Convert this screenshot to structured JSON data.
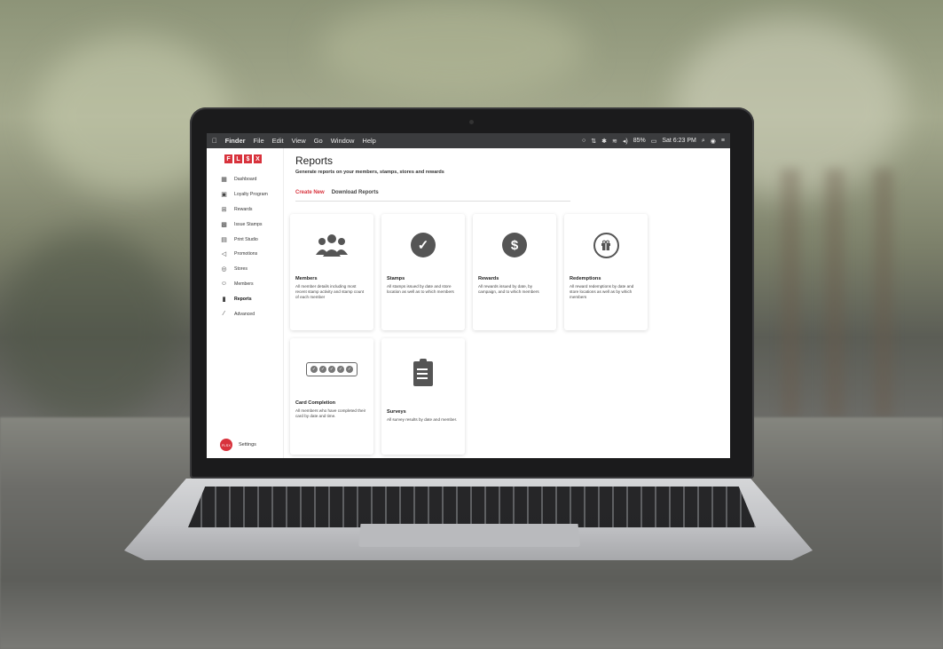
{
  "menubar": {
    "apple": "",
    "items": [
      "Finder",
      "File",
      "Edit",
      "View",
      "Go",
      "Window",
      "Help"
    ],
    "battery": "85%",
    "clock": "Sat 6:23 PM"
  },
  "app": {
    "logo_letters": [
      "F",
      "L",
      "$",
      "X"
    ],
    "nav": [
      {
        "label": "Dashboard",
        "icon": "dashboard-icon",
        "glyph": "▦"
      },
      {
        "label": "Loyalty Program",
        "icon": "loyalty-icon",
        "glyph": "▣"
      },
      {
        "label": "Rewards",
        "icon": "gift-icon",
        "glyph": "⊞"
      },
      {
        "label": "Issue Stamps",
        "icon": "qr-icon",
        "glyph": "▩"
      },
      {
        "label": "Print Studio",
        "icon": "print-icon",
        "glyph": "▤"
      },
      {
        "label": "Promotions",
        "icon": "megaphone-icon",
        "glyph": "◁"
      },
      {
        "label": "Stores",
        "icon": "location-icon",
        "glyph": "◎"
      },
      {
        "label": "Members",
        "icon": "members-icon",
        "glyph": "☺"
      },
      {
        "label": "Reports",
        "icon": "reports-icon",
        "glyph": "▮"
      },
      {
        "label": "Advanced",
        "icon": "wand-icon",
        "glyph": "⁄"
      }
    ],
    "active_nav": "Reports",
    "settings_label": "Settings",
    "avatar_text": "FLSX"
  },
  "page": {
    "title": "Reports",
    "subtitle": "Generate reports on your members, stamps, stores and rewards",
    "tabs": [
      "Create New",
      "Download Reports"
    ],
    "active_tab": "Create New"
  },
  "cards": [
    {
      "title": "Members",
      "desc": "All member details including most recent stamp activity and stamp count of each member",
      "icon": "users-icon"
    },
    {
      "title": "Stamps",
      "desc": "All stamps issued by date and store location as well as to which members",
      "icon": "checkmark-icon"
    },
    {
      "title": "Rewards",
      "desc": "All rewards issued by date, by campaign, and to which members",
      "icon": "dollar-icon"
    },
    {
      "title": "Redemptions",
      "desc": "All reward redemptions by date and store locations as well as by which members",
      "icon": "gift-icon"
    },
    {
      "title": "Card Completion",
      "desc": "All members who have completed their card by date and time.",
      "icon": "stamp-card-icon"
    },
    {
      "title": "Surveys",
      "desc": "All survey results by date and member.",
      "icon": "clipboard-icon"
    }
  ],
  "colors": {
    "accent": "#d8323c",
    "icon": "#555555"
  }
}
